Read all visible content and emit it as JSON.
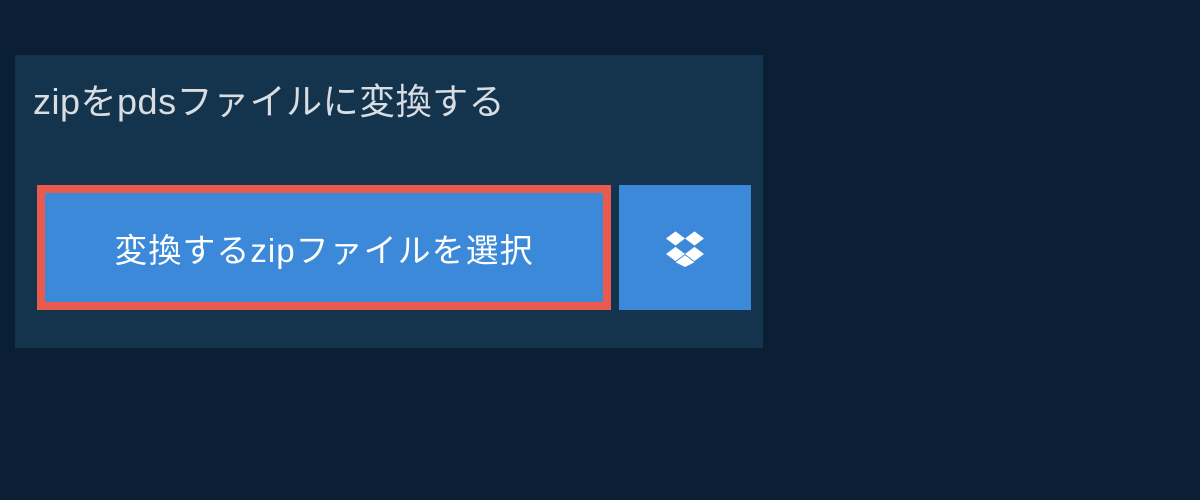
{
  "title": "zipをpdsファイルに変換する",
  "buttons": {
    "select_label": "変換するzipファイルを選択"
  },
  "colors": {
    "page_bg": "#0a1f33",
    "panel_bg": "#14334d",
    "button_bg": "#3b89d8",
    "button_border": "#e85b4e",
    "title_color": "#d8dde2",
    "button_text": "#ffffff"
  }
}
